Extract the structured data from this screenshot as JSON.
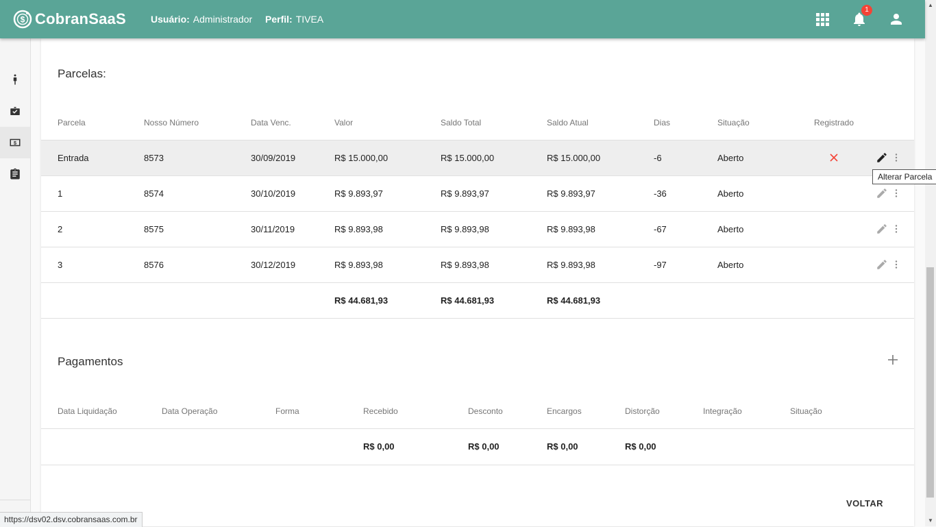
{
  "app": {
    "brand": "CobranSaaS"
  },
  "header": {
    "user_label": "Usuário:",
    "user_value": "Administrador",
    "profile_label": "Perfil:",
    "profile_value": "TIVEA",
    "notification_count": "1"
  },
  "parcelas": {
    "title": "Parcelas:",
    "columns": [
      "Parcela",
      "Nosso Número",
      "Data Venc.",
      "Valor",
      "Saldo Total",
      "Saldo Atual",
      "Dias",
      "Situação",
      "Registrado"
    ],
    "rows": [
      {
        "parcela": "Entrada",
        "nosso_numero": "8573",
        "data_venc": "30/09/2019",
        "valor": "R$ 15.000,00",
        "saldo_total": "R$ 15.000,00",
        "saldo_atual": "R$ 15.000,00",
        "dias": "-6",
        "situacao": "Aberto",
        "registrado": "no"
      },
      {
        "parcela": "1",
        "nosso_numero": "8574",
        "data_venc": "30/10/2019",
        "valor": "R$ 9.893,97",
        "saldo_total": "R$ 9.893,97",
        "saldo_atual": "R$ 9.893,97",
        "dias": "-36",
        "situacao": "Aberto",
        "registrado": ""
      },
      {
        "parcela": "2",
        "nosso_numero": "8575",
        "data_venc": "30/11/2019",
        "valor": "R$ 9.893,98",
        "saldo_total": "R$ 9.893,98",
        "saldo_atual": "R$ 9.893,98",
        "dias": "-67",
        "situacao": "Aberto",
        "registrado": ""
      },
      {
        "parcela": "3",
        "nosso_numero": "8576",
        "data_venc": "30/12/2019",
        "valor": "R$ 9.893,98",
        "saldo_total": "R$ 9.893,98",
        "saldo_atual": "R$ 9.893,98",
        "dias": "-97",
        "situacao": "Aberto",
        "registrado": ""
      }
    ],
    "totals": {
      "valor": "R$ 44.681,93",
      "saldo_total": "R$ 44.681,93",
      "saldo_atual": "R$ 44.681,93"
    },
    "tooltip": "Alterar Parcela"
  },
  "pagamentos": {
    "title": "Pagamentos",
    "columns": [
      "Data Liquidação",
      "Data Operação",
      "Forma",
      "Recebido",
      "Desconto",
      "Encargos",
      "Distorção",
      "Integração",
      "Situação"
    ],
    "totals": {
      "recebido": "R$ 0,00",
      "desconto": "R$ 0,00",
      "encargos": "R$ 0,00",
      "distorcao": "R$ 0,00"
    }
  },
  "actions": {
    "back_label": "VOLTAR"
  },
  "status_url": "https://dsv02.dsv.cobransaas.com.br",
  "colors": {
    "primary": "#5aa597",
    "danger": "#f44336"
  },
  "icons": {
    "sidebar": [
      "person-icon",
      "briefcase-check-icon",
      "money-icon",
      "clipboard-icon"
    ],
    "header": [
      "apps-grid-icon",
      "bell-icon",
      "account-icon"
    ],
    "row_actions": [
      "pencil-icon",
      "more-vert-icon"
    ]
  }
}
